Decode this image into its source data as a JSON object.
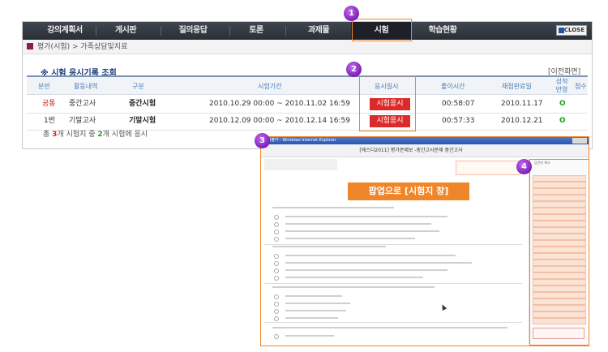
{
  "nav": {
    "items": [
      "강의계획서",
      "게시판",
      "질의응답",
      "토론",
      "과제물",
      "시험",
      "학습현황"
    ],
    "close_label": "CLOSE"
  },
  "breadcrumb": "평가(시험) > 가족상담및치료",
  "section": {
    "title": "※ 시험 응시기록 조회",
    "prev_link": "[이전화면]"
  },
  "table": {
    "headers": {
      "division": "분반",
      "activity": "활동내역",
      "type": "구분",
      "period": "시험기간",
      "exam_date": "응시일시",
      "solve_time": "풀이시간",
      "grading_date": "채점완료일",
      "grade_reflect": "성적\n반영",
      "score": "점수"
    },
    "rows": [
      {
        "division": "공통",
        "activity": "중간고사",
        "type": "중간시험",
        "period": "2010.10.29  00:00 ~ 2010.11.02  16:59",
        "exam_button": "시험응시",
        "solve_time": "00:58:07",
        "grading_date": "2010.11.17",
        "reflect": "O"
      },
      {
        "division": "1반",
        "activity": "기말고사",
        "type": "기말시험",
        "period": "2010.12.09  00:00 ~ 2010.12.14  16:59",
        "exam_button": "시험응시",
        "solve_time": "00:57:33",
        "grading_date": "2010.12.21",
        "reflect": "O"
      }
    ]
  },
  "summary": {
    "prefix": "총 ",
    "total": "3",
    "middle": "개 시험지 중 ",
    "taken": "2",
    "suffix": "개 시험에 응시"
  },
  "badges": [
    "1",
    "2",
    "3",
    "4"
  ],
  "popup": {
    "window_title": "강의평가 - Windows Internet Explorer",
    "heading": "[에스디2011] 평가문제보 -중간고사문제 중간고사",
    "banner": "팝업으로 [시험지 창]",
    "answer_header": "답안지 체크"
  },
  "colors": {
    "highlight": "#f0862a",
    "badge": "#8b2fc9",
    "exam_button": "#dc2a2a",
    "nav_bg": "#343a42"
  }
}
